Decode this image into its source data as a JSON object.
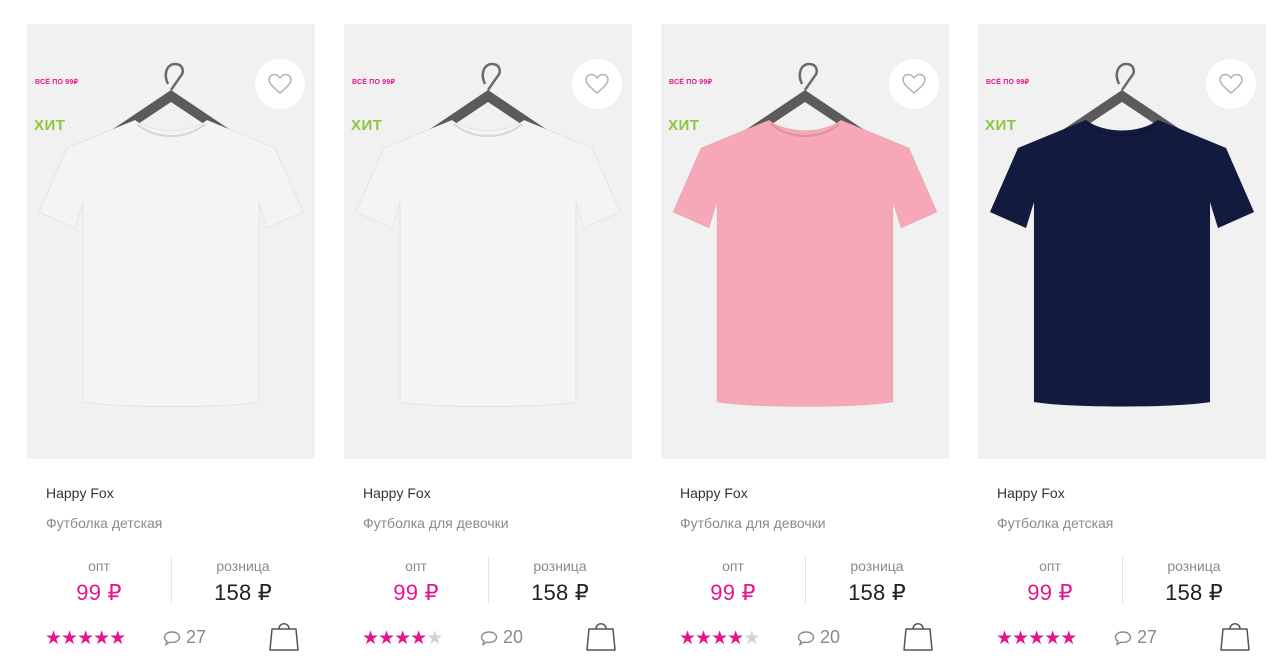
{
  "products": [
    {
      "promo": "ВСЁ ПО 99₽",
      "hit": "ХИТ",
      "brand": "Happy Fox",
      "title": "Футболка детская",
      "opt_label": "опт",
      "opt_price": "99 ₽",
      "retail_label": "розница",
      "retail_price": "158 ₽",
      "rating": 5,
      "reviews": "27",
      "shirt_color": "#f4f4f6"
    },
    {
      "promo": "ВСЁ ПО 99₽",
      "hit": "ХИТ",
      "brand": "Happy Fox",
      "title": "Футболка для девочки",
      "opt_label": "опт",
      "opt_price": "99 ₽",
      "retail_label": "розница",
      "retail_price": "158 ₽",
      "rating": 4,
      "reviews": "20",
      "shirt_color": "#f4f4f6"
    },
    {
      "promo": "ВСЁ ПО 99₽",
      "hit": "ХИТ",
      "brand": "Happy Fox",
      "title": "Футболка для девочки",
      "opt_label": "опт",
      "opt_price": "99 ₽",
      "retail_label": "розница",
      "retail_price": "158 ₽",
      "rating": 4,
      "reviews": "20",
      "shirt_color": "#f7a8b8"
    },
    {
      "promo": "ВСЁ ПО 99₽",
      "hit": "ХИТ",
      "brand": "Happy Fox",
      "title": "Футболка детская",
      "opt_label": "опт",
      "opt_price": "99 ₽",
      "retail_label": "розница",
      "retail_price": "158 ₽",
      "rating": 5,
      "reviews": "27",
      "shirt_color": "#121a3e"
    }
  ],
  "colors": {
    "accent": "#e5168c",
    "hit": "#8dc63f",
    "muted": "#8a8a8a"
  },
  "icons": {
    "favorite": "heart-icon",
    "comments": "comment-icon",
    "cart": "shopping-bag-icon",
    "rating": "star-icon"
  }
}
